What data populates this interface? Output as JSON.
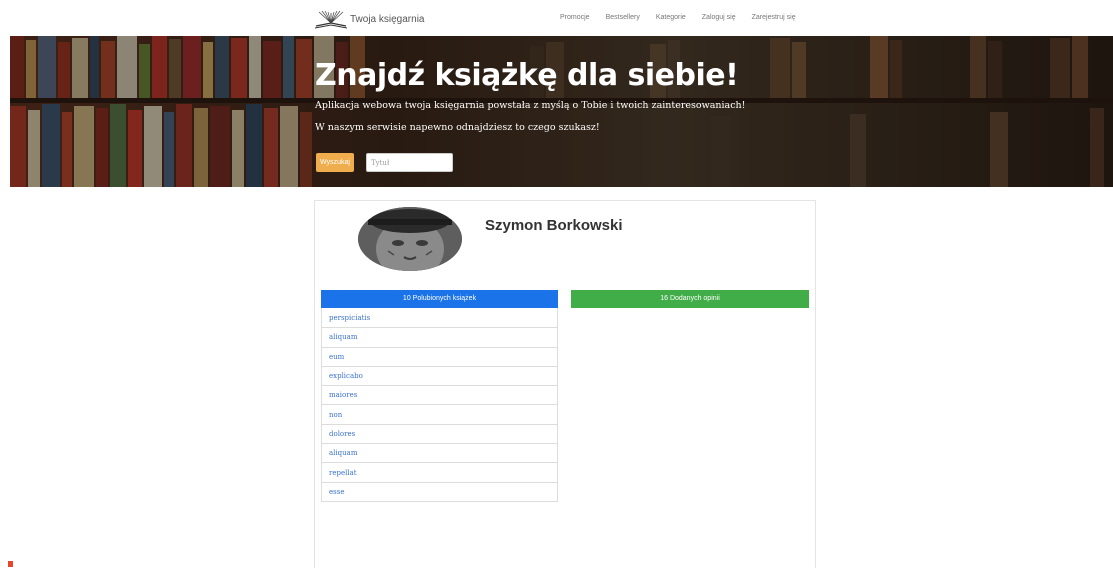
{
  "navbar": {
    "brand": "Twoja księgarnia",
    "links": [
      "Promocje",
      "Bestsellery",
      "Kategorie",
      "Zaloguj się",
      "Zarejestruj się"
    ]
  },
  "hero": {
    "title": "Znajdź książkę dla siebie!",
    "subtitle_line1": "Aplikacja webowa twoja księgarnia powstała z myślą o Tobie i twoich zainteresowaniach!",
    "subtitle_line2": "W naszym serwisie napewno odnajdziesz to czego szukasz!",
    "search_button": "Wyszukaj",
    "search_placeholder": "Tytuł"
  },
  "profile": {
    "name": "Szymon Borkowski",
    "liked_tab": "10 Polubionych książek",
    "reviews_tab": "16 Dodanych opinii",
    "liked_books": [
      "perspiciatis",
      "aliquam",
      "eum",
      "explicabo",
      "maiores",
      "non",
      "dolores",
      "aliquam",
      "repellat",
      "esse"
    ]
  },
  "colors": {
    "accent_blue": "#1a73e8",
    "accent_green": "#41ad48",
    "search_orange": "#f0ad4e",
    "link_blue": "#3b73c9"
  }
}
